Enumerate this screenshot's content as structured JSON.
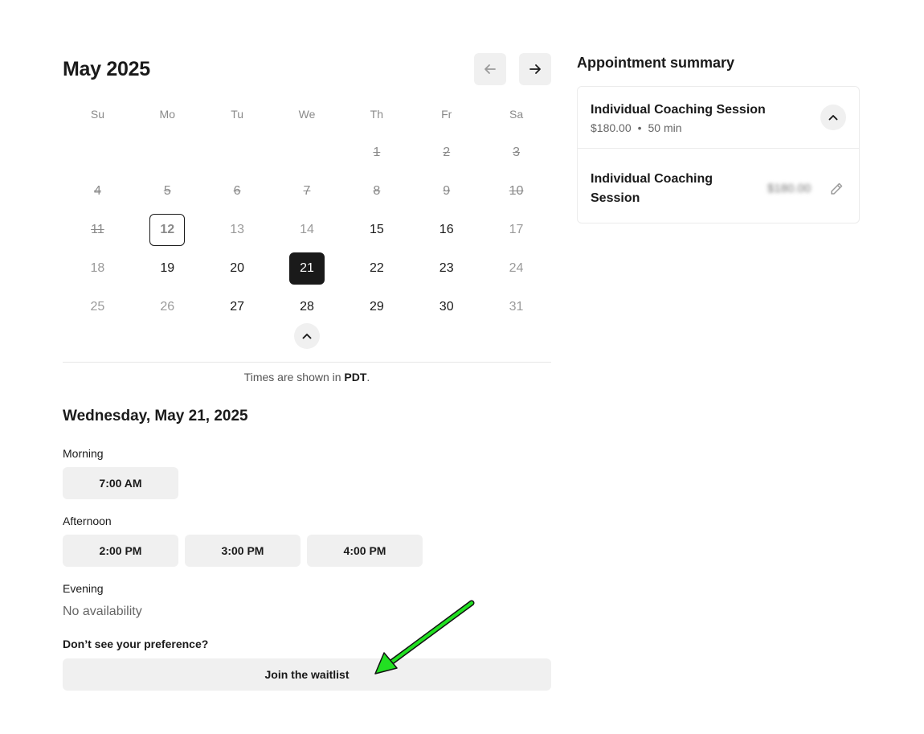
{
  "calendar": {
    "month_title": "May 2025",
    "weekdays": [
      "Su",
      "Mo",
      "Tu",
      "We",
      "Th",
      "Fr",
      "Sa"
    ],
    "weeks": [
      [
        {
          "label": ""
        },
        {
          "label": ""
        },
        {
          "label": ""
        },
        {
          "label": ""
        },
        {
          "label": "1",
          "state": "past"
        },
        {
          "label": "2",
          "state": "past"
        },
        {
          "label": "3",
          "state": "past"
        }
      ],
      [
        {
          "label": "4",
          "state": "past"
        },
        {
          "label": "5",
          "state": "past"
        },
        {
          "label": "6",
          "state": "past"
        },
        {
          "label": "7",
          "state": "past"
        },
        {
          "label": "8",
          "state": "past"
        },
        {
          "label": "9",
          "state": "past"
        },
        {
          "label": "10",
          "state": "past"
        }
      ],
      [
        {
          "label": "11",
          "state": "past"
        },
        {
          "label": "12",
          "state": "today"
        },
        {
          "label": "13",
          "state": "unavail"
        },
        {
          "label": "14",
          "state": "unavail"
        },
        {
          "label": "15",
          "state": "avail"
        },
        {
          "label": "16",
          "state": "avail"
        },
        {
          "label": "17",
          "state": "unavail"
        }
      ],
      [
        {
          "label": "18",
          "state": "unavail"
        },
        {
          "label": "19",
          "state": "avail"
        },
        {
          "label": "20",
          "state": "avail"
        },
        {
          "label": "21",
          "state": "selected"
        },
        {
          "label": "22",
          "state": "avail"
        },
        {
          "label": "23",
          "state": "avail"
        },
        {
          "label": "24",
          "state": "unavail"
        }
      ],
      [
        {
          "label": "25",
          "state": "unavail"
        },
        {
          "label": "26",
          "state": "unavail"
        },
        {
          "label": "27",
          "state": "avail"
        },
        {
          "label": "28",
          "state": "avail"
        },
        {
          "label": "29",
          "state": "avail"
        },
        {
          "label": "30",
          "state": "avail"
        },
        {
          "label": "31",
          "state": "unavail"
        }
      ]
    ],
    "prev_icon": "arrow-left-icon",
    "next_icon": "arrow-right-icon",
    "collapse_icon": "chevron-up-icon"
  },
  "timezone": {
    "prefix": "Times are shown in ",
    "zone": "PDT",
    "suffix": "."
  },
  "day_schedule": {
    "date_heading": "Wednesday, May 21, 2025",
    "morning_label": "Morning",
    "morning_slots": [
      "7:00 AM"
    ],
    "afternoon_label": "Afternoon",
    "afternoon_slots": [
      "2:00 PM",
      "3:00 PM",
      "4:00 PM"
    ],
    "evening_label": "Evening",
    "evening_empty": "No availability"
  },
  "waitlist": {
    "question": "Don’t see your preference?",
    "button_label": "Join the waitlist"
  },
  "summary": {
    "title": "Appointment summary",
    "service_name": "Individual Coaching Session",
    "service_price": "$180.00",
    "service_separator": "•",
    "service_duration": "50 min",
    "item_name": "Individual Coaching Session",
    "item_price": "$180.00",
    "expand_icon": "chevron-up-icon",
    "edit_icon": "pencil-icon"
  },
  "colors": {
    "accent_dark": "#1a1a1a",
    "button_bg": "#f0f0f0",
    "annotation_arrow": "#22e022"
  }
}
